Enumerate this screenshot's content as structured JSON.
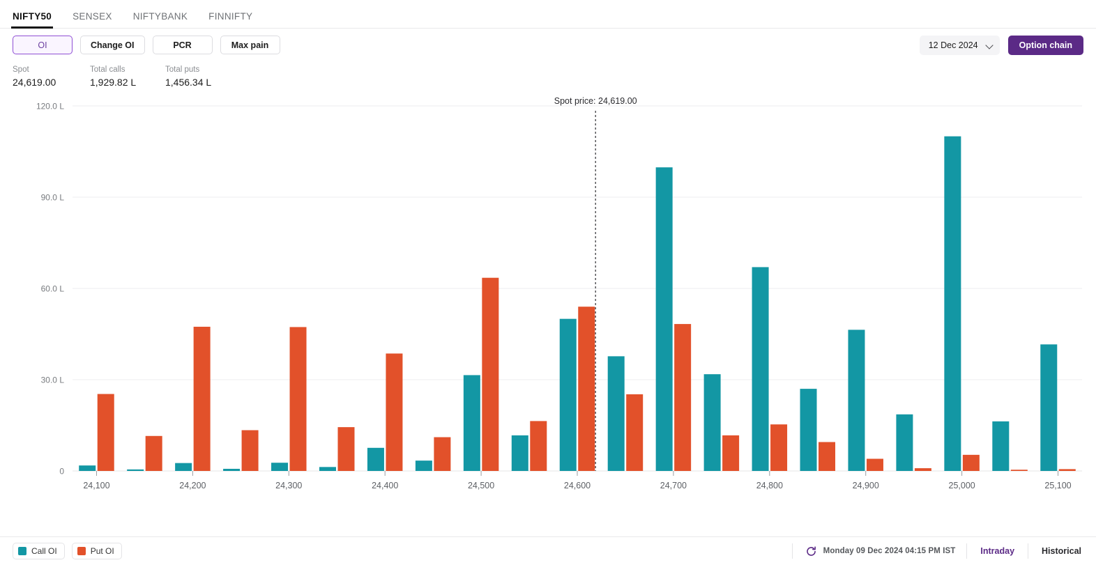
{
  "tabs": [
    {
      "label": "NIFTY50",
      "active": true
    },
    {
      "label": "SENSEX",
      "active": false
    },
    {
      "label": "NIFTYBANK",
      "active": false
    },
    {
      "label": "FINNIFTY",
      "active": false
    }
  ],
  "toolbar": {
    "segments": [
      {
        "label": "OI",
        "selected": true
      },
      {
        "label": "Change OI",
        "selected": false
      },
      {
        "label": "PCR",
        "selected": false
      },
      {
        "label": "Max pain",
        "selected": false
      }
    ],
    "expiry_value": "12 Dec 2024",
    "option_chain_label": "Option chain"
  },
  "stats": [
    {
      "label": "Spot",
      "value": "24,619.00"
    },
    {
      "label": "Total calls",
      "value": "1,929.82 L"
    },
    {
      "label": "Total puts",
      "value": "1,456.34 L"
    }
  ],
  "footer": {
    "legend": [
      {
        "label": "Call OI",
        "color": "#1397a4"
      },
      {
        "label": "Put OI",
        "color": "#e2512a"
      }
    ],
    "timestamp": "Monday 09 Dec 2024 04:15 PM IST",
    "modes": [
      {
        "label": "Intraday",
        "active": true
      },
      {
        "label": "Historical",
        "active": false
      }
    ]
  },
  "colors": {
    "call": "#1397a4",
    "put": "#e2512a",
    "accent": "#5b2a86",
    "segment_selected_border": "#8f4fd4",
    "grid": "#ededef"
  },
  "chart_data": {
    "type": "bar",
    "title": "",
    "xlabel": "",
    "ylabel": "",
    "unit": "L",
    "ylim": [
      0,
      120
    ],
    "yticks": [
      0,
      30,
      60,
      90,
      120
    ],
    "ytick_labels": [
      "0",
      "30.0 L",
      "60.0 L",
      "90.0 L",
      "120.0 L"
    ],
    "grid": true,
    "legend_position": "bottom-left",
    "xtick_labels": [
      "24,100",
      "24,200",
      "24,300",
      "24,400",
      "24,500",
      "24,600",
      "24,700",
      "24,800",
      "24,900",
      "25,000",
      "25,100"
    ],
    "categories": [
      "24,100",
      "24,150",
      "24,200",
      "24,250",
      "24,300",
      "24,350",
      "24,400",
      "24,450",
      "24,500",
      "24,550",
      "24,600",
      "24,650",
      "24,700",
      "24,750",
      "24,800",
      "24,850",
      "24,900",
      "24,950",
      "25,000",
      "25,050",
      "25,100"
    ],
    "series": [
      {
        "name": "Call OI",
        "color": "#1397a4",
        "values": [
          1.8,
          0.5,
          2.6,
          0.7,
          2.7,
          1.3,
          7.6,
          3.4,
          31.5,
          11.7,
          50.0,
          37.7,
          99.8,
          31.8,
          67.0,
          27.0,
          46.4,
          18.6,
          110.0,
          16.3,
          41.6
        ]
      },
      {
        "name": "Put OI",
        "color": "#e2512a",
        "values": [
          25.3,
          11.5,
          47.4,
          13.4,
          47.3,
          14.4,
          38.6,
          11.1,
          63.5,
          16.4,
          54.0,
          25.2,
          48.3,
          11.7,
          15.3,
          9.5,
          4.0,
          0.9,
          5.3,
          0.4,
          0.6
        ]
      }
    ],
    "annotations": [
      {
        "type": "vline",
        "label": "Spot price: 24,619.00",
        "value": 24619.0,
        "style": "dashed"
      }
    ]
  }
}
